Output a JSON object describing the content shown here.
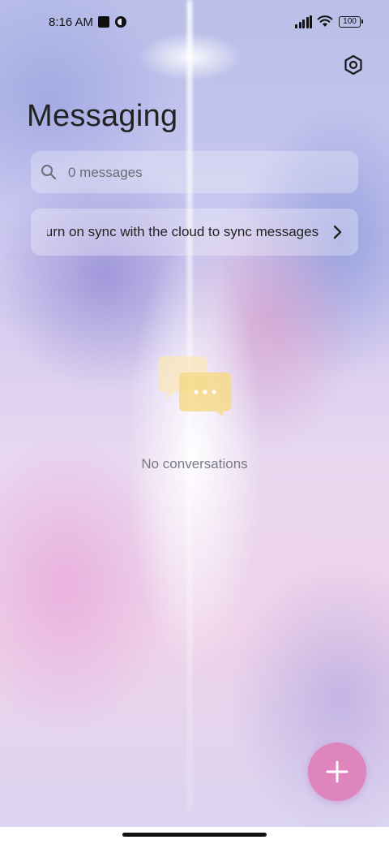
{
  "status_bar": {
    "time": "8:16 AM",
    "battery_level": "100",
    "icons": [
      "stop-icon",
      "app-status-icon",
      "signal-icon",
      "wifi-icon",
      "battery-icon"
    ]
  },
  "header": {
    "title": "Messaging",
    "settings_icon": "settings-hexagon-icon"
  },
  "search": {
    "placeholder": "0 messages",
    "value": ""
  },
  "sync_banner": {
    "text": "Turn on sync with the cloud to sync messages"
  },
  "empty_state": {
    "icon": "chat-bubbles-icon",
    "text": "No conversations"
  },
  "fab": {
    "icon": "plus-icon",
    "color": "#dd85bc"
  },
  "colors": {
    "accent": "#dd85bc",
    "empty_icon": "#f6d98a"
  }
}
